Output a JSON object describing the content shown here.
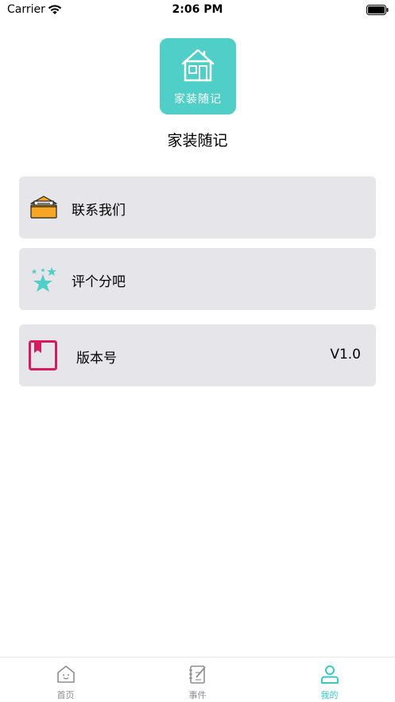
{
  "status_bar": {
    "carrier": "Carrier",
    "time": "2:06 PM"
  },
  "header": {
    "logo_text": "家装随记",
    "app_name": "家装随记"
  },
  "menu": [
    {
      "label": "联系我们",
      "icon": "mail-icon"
    },
    {
      "label": "评个分吧",
      "icon": "stars-icon"
    },
    {
      "label": "版本号",
      "value": "V1.0",
      "icon": "bookmark-icon"
    }
  ],
  "tab_bar": {
    "tabs": [
      {
        "label": "首页",
        "icon": "home-icon"
      },
      {
        "label": "事件",
        "icon": "notebook-icon"
      },
      {
        "label": "我的",
        "icon": "person-icon"
      }
    ],
    "active_index": 2
  },
  "colors": {
    "accent": "#38c9c1",
    "logo_bg": "#4fcfc7",
    "card_bg": "#e5e5ea",
    "bookmark": "#d81b60",
    "mail": "#f5a623"
  }
}
